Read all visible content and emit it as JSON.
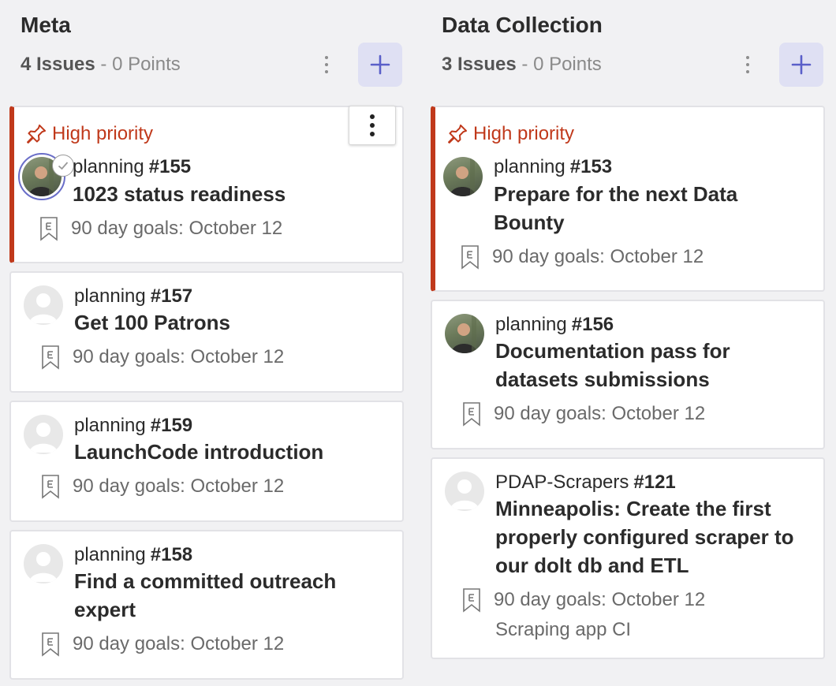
{
  "colors": {
    "accent": "#5a5fc9",
    "priority": "#c0391b",
    "add_button_bg": "#dfe0f3",
    "background": "#f1f1f3"
  },
  "columns": [
    {
      "title": "Meta",
      "issues_label": "4 Issues",
      "points_label": " - 0 Points",
      "cards": [
        {
          "priority_label": "High priority",
          "repo": "planning",
          "number": "#155",
          "title": "1023 status readiness",
          "milestone": "90 day goals: October 12",
          "avatar": "photo-with-check"
        },
        {
          "repo": "planning",
          "number": "#157",
          "title": "Get 100 Patrons",
          "milestone": "90 day goals: October 12",
          "avatar": "blank"
        },
        {
          "repo": "planning",
          "number": "#159",
          "title": "LaunchCode introduction",
          "milestone": "90 day goals: October 12",
          "avatar": "blank"
        },
        {
          "repo": "planning",
          "number": "#158",
          "title": "Find a committed outreach expert",
          "milestone": "90 day goals: October 12",
          "avatar": "blank"
        }
      ]
    },
    {
      "title": "Data Collection",
      "issues_label": "3 Issues",
      "points_label": " - 0 Points",
      "cards": [
        {
          "priority_label": "High priority",
          "repo": "planning",
          "number": "#153",
          "title": "Prepare for the next Data Bounty",
          "milestone": "90 day goals: October 12",
          "avatar": "photo"
        },
        {
          "repo": "planning",
          "number": "#156",
          "title": "Documentation pass for datasets submissions",
          "milestone": "90 day goals: October 12",
          "avatar": "photo"
        },
        {
          "repo": "PDAP-Scrapers",
          "number": "#121",
          "title": "Minneapolis: Create the first properly configured scraper to our dolt db and ETL",
          "milestone": "90 day goals: October 12",
          "extra": "Scraping app CI",
          "avatar": "blank"
        }
      ]
    }
  ],
  "icons": {
    "column_menu": "kebab-icon",
    "add": "plus-icon",
    "card_menu": "kebab-icon",
    "priority": "pin-icon",
    "milestone": "milestone-bookmark-icon",
    "assigned": "check-circle-icon"
  }
}
